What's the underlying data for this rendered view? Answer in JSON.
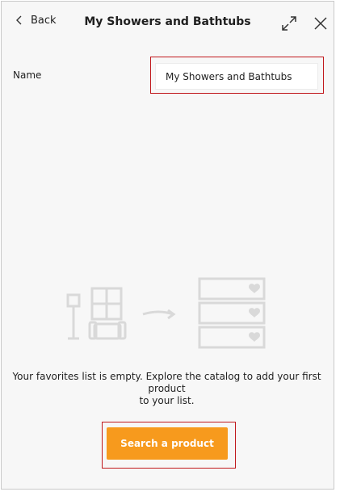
{
  "header": {
    "back_label": "Back",
    "title": "My Showers and Bathtubs",
    "expand_icon": "expand-icon",
    "close_icon": "close-icon"
  },
  "form": {
    "name_label": "Name",
    "name_value": "My Showers and Bathtubs"
  },
  "empty_state": {
    "message_line1": "Your favorites list is empty. Explore the catalog to add your first product",
    "message_line2": "to your list.",
    "illustration_icons": [
      "lamp-icon",
      "window-icon",
      "armchair-icon",
      "arrow-right-icon",
      "drawer-list-icon",
      "heart-icon"
    ]
  },
  "cta": {
    "label": "Search a product",
    "color": "#f79a1d"
  },
  "colors": {
    "highlight": "#c0181c",
    "panel_bg": "#f7f7f7",
    "illustration": "#d9d9d9"
  }
}
